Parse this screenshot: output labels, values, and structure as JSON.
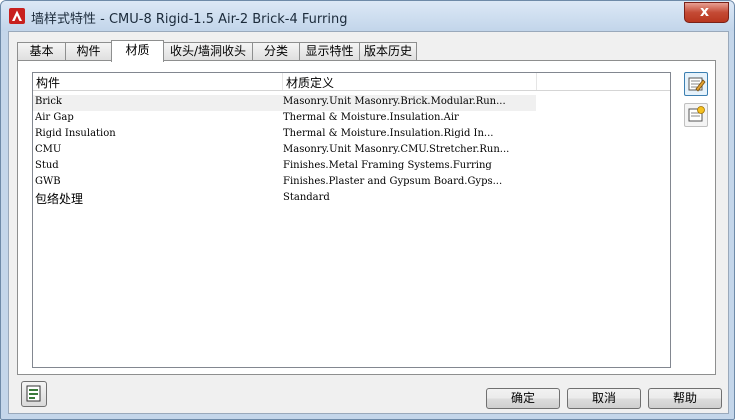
{
  "window": {
    "title": "墙样式特性 - CMU-8 Rigid-1.5 Air-2 Brick-4 Furring",
    "close_glyph": "x"
  },
  "tabs": [
    {
      "label": "基本"
    },
    {
      "label": "构件"
    },
    {
      "label": "材质"
    },
    {
      "label": "收头/墙洞收头"
    },
    {
      "label": "分类"
    },
    {
      "label": "显示特性"
    },
    {
      "label": "版本历史"
    }
  ],
  "active_tab": "材质",
  "grid": {
    "columns": [
      "构件",
      "材质定义"
    ],
    "rows": [
      {
        "component": "Brick",
        "material": "Masonry.Unit Masonry.Brick.Modular.Run..."
      },
      {
        "component": "Air Gap",
        "material": "Thermal & Moisture.Insulation.Air"
      },
      {
        "component": "Rigid Insulation",
        "material": "Thermal & Moisture.Insulation.Rigid In..."
      },
      {
        "component": "CMU",
        "material": "Masonry.Unit Masonry.CMU.Stretcher.Run..."
      },
      {
        "component": "Stud",
        "material": "Finishes.Metal Framing Systems.Furring"
      },
      {
        "component": "GWB",
        "material": "Finishes.Plaster and Gypsum Board.Gyps..."
      },
      {
        "component": "包络处理",
        "material": "Standard"
      }
    ]
  },
  "side_buttons": [
    {
      "icon": "edit-material-icon"
    },
    {
      "icon": "new-material-icon"
    }
  ],
  "footer": {
    "ok_label": "确定",
    "cancel_label": "取消",
    "help_label": "帮助",
    "corner_icon": "style-browser-icon"
  },
  "colors": {
    "title_gradient": "#c2d5ea",
    "close_red": "#c44a35",
    "accent_blue": "#3c7fb1"
  }
}
